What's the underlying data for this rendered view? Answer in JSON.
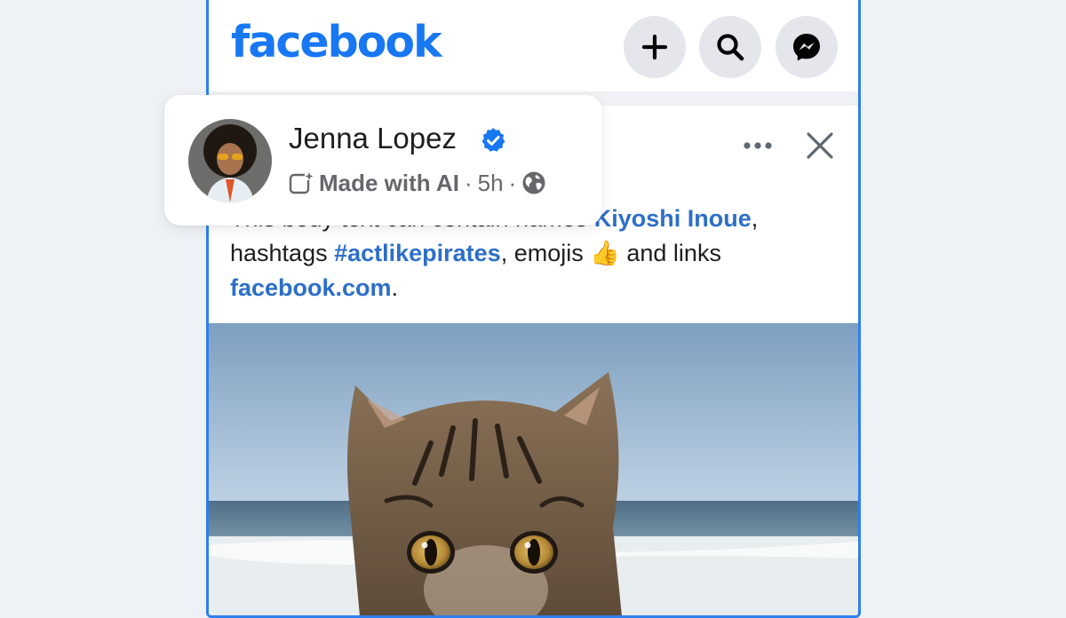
{
  "header": {
    "logo_text": "facebook",
    "buttons": [
      {
        "name": "create",
        "icon": "plus-icon"
      },
      {
        "name": "search",
        "icon": "search-icon"
      },
      {
        "name": "messenger",
        "icon": "messenger-icon"
      }
    ]
  },
  "author": {
    "name": "Jenna Lopez",
    "verified": true,
    "ai_label": "Made with AI",
    "separator": "·",
    "time": "5h",
    "audience_icon": "globe-icon"
  },
  "post": {
    "body_line1_text": "This body text can contain names ",
    "body_link_name": "Kiyoshi Inoue",
    "body_line1_end": ",",
    "body_line2_text": "hashtags ",
    "body_hashtag": "#actlikepirates",
    "body_line2_mid": ", emojis ",
    "body_emoji": "👍",
    "body_line2_end": " and links",
    "body_link_url": "facebook.com",
    "body_line3_end": ".",
    "image_subject": "tabby cat on a beach"
  },
  "colors": {
    "brand_blue": "#1877f2",
    "link_blue": "#2d6fc8",
    "frame_blue": "#2d7ff0",
    "button_grey": "#e4e6eb",
    "background": "#eef1f5"
  }
}
